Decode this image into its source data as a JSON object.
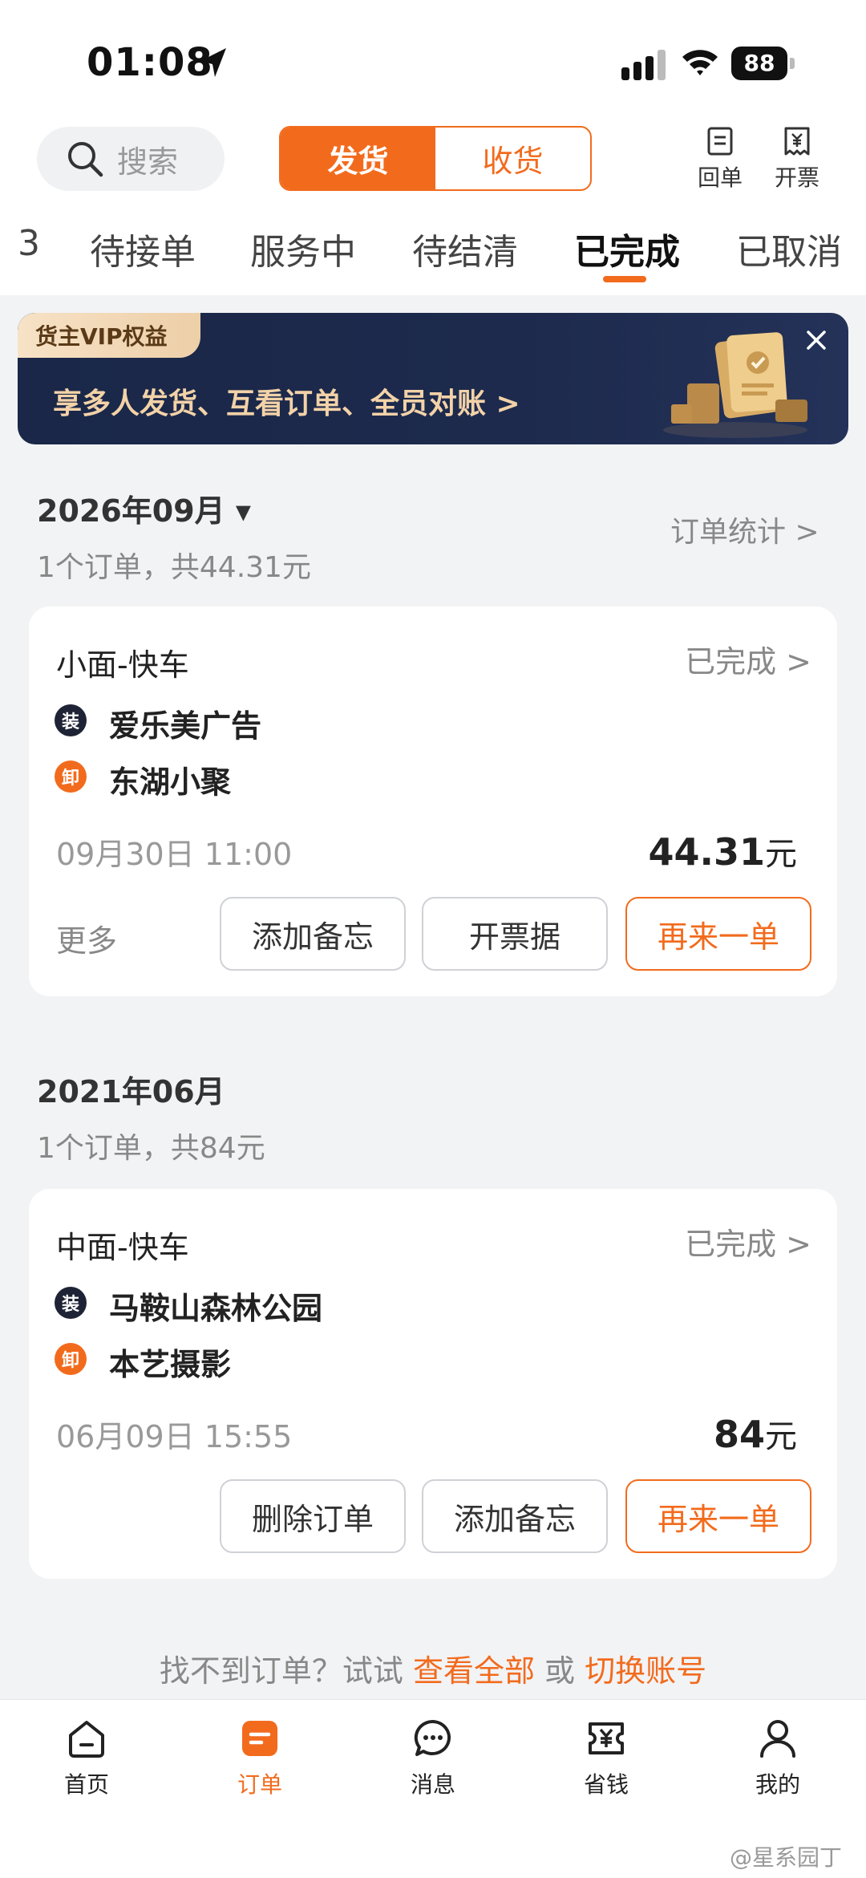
{
  "status_bar": {
    "time": "01:08",
    "battery": "88"
  },
  "header": {
    "search_placeholder": "搜索",
    "segment": [
      "发货",
      "收货"
    ],
    "receipt_label": "回单",
    "invoice_label": "开票"
  },
  "tabs": [
    "3",
    "待接单",
    "服务中",
    "待结清",
    "已完成",
    "已取消"
  ],
  "banner": {
    "tag": "货主VIP权益",
    "text": "享多人发货、互看订单、全员对账 >"
  },
  "months": [
    {
      "label": "2026年09月 ▾",
      "summary": "1个订单，共44.31元",
      "stats_link": "订单统计 >"
    },
    {
      "label": "2021年06月",
      "summary": "1个订单，共84元"
    }
  ],
  "orders": [
    {
      "vehicle": "小面-快车",
      "status": "已完成 >",
      "load_badge": "装",
      "load_addr": "爱乐美广告",
      "unload_badge": "卸",
      "unload_addr": "东湖小聚",
      "date": "09月30日 11:00",
      "price": "44.31",
      "currency": "元",
      "more": "更多",
      "buttons": [
        "添加备忘",
        "开票据",
        "再来一单"
      ]
    },
    {
      "vehicle": "中面-快车",
      "status": "已完成 >",
      "load_badge": "装",
      "load_addr": "马鞍山森林公园",
      "unload_badge": "卸",
      "unload_addr": "本艺摄影",
      "date": "06月09日 15:55",
      "price": "84",
      "currency": "元",
      "buttons": [
        "删除订单",
        "添加备忘",
        "再来一单"
      ]
    }
  ],
  "hint": {
    "prefix": "找不到订单？试试 ",
    "link1": "查看全部",
    "mid": " 或 ",
    "link2": "切换账号"
  },
  "bottom_nav": [
    "首页",
    "订单",
    "消息",
    "省钱",
    "我的"
  ],
  "watermark": "@星系园丁",
  "colors": {
    "accent": "#f26b1d",
    "banner_bg": "#1d2a4d",
    "page_bg": "#f2f3f5"
  }
}
